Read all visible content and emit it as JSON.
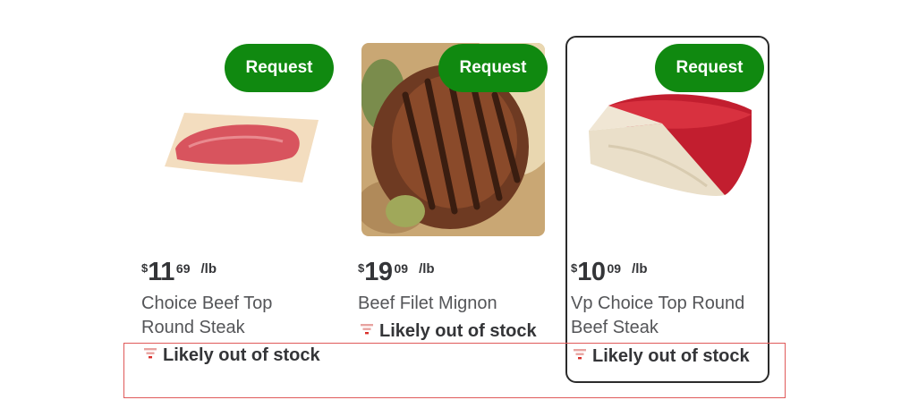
{
  "products": [
    {
      "request_label": "Request",
      "price": {
        "currency": "$",
        "dollars": "11",
        "cents": "69",
        "unit": "/lb"
      },
      "name": "Choice Beef Top Round Steak",
      "stock_status": "Likely out of stock"
    },
    {
      "request_label": "Request",
      "price": {
        "currency": "$",
        "dollars": "19",
        "cents": "09",
        "unit": "/lb"
      },
      "name": "Beef Filet Mignon",
      "stock_status": "Likely out of stock"
    },
    {
      "request_label": "Request",
      "price": {
        "currency": "$",
        "dollars": "10",
        "cents": "09",
        "unit": "/lb"
      },
      "name": "Vp Choice Top Round Beef Steak",
      "stock_status": "Likely out of stock"
    }
  ],
  "colors": {
    "request_button": "#108910",
    "stock_icon": "#d9302b",
    "highlight_border": "#e05a5a",
    "selected_border": "#2b2b2b"
  }
}
